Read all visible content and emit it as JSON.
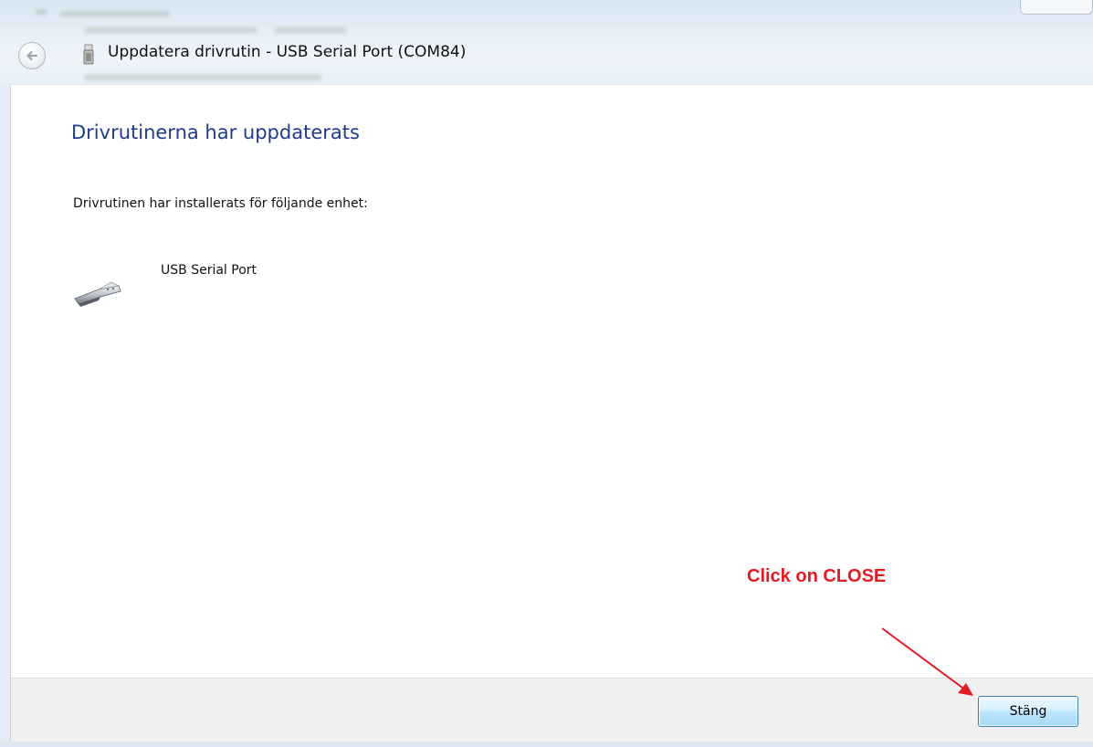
{
  "window": {
    "title": "Uppdatera drivrutin - USB Serial Port (COM84)"
  },
  "icons": {
    "back": "back-arrow-icon",
    "title": "usb-device-icon",
    "device": "serial-port-connector-icon"
  },
  "main": {
    "heading": "Drivrutinerna har uppdaterats",
    "instruction": "Drivrutinen har installerats för följande enhet:",
    "device_name": "USB Serial Port"
  },
  "footer": {
    "close_label": "Stäng"
  },
  "annotation": {
    "text": "Click on CLOSE",
    "color": "#e31b23"
  },
  "colors": {
    "heading": "#1f3b8f",
    "button_border": "#3c7fb1"
  }
}
